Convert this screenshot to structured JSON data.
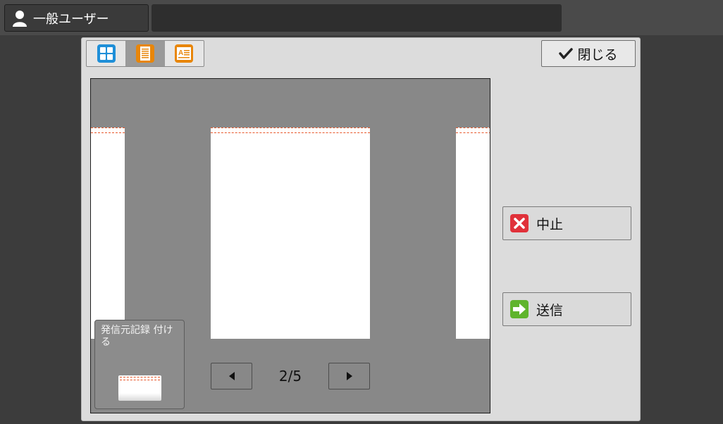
{
  "topbar": {
    "user_label": "一般ユーザー",
    "user_icon": "user-icon"
  },
  "toolbar": {
    "view_tabs": [
      {
        "icon": "grid-view-icon",
        "color": "#1f8fd8",
        "active": false
      },
      {
        "icon": "page-view-icon",
        "color": "#e8860a",
        "active": true
      },
      {
        "icon": "text-page-view-icon",
        "color": "#e8860a",
        "active": false
      }
    ],
    "close_label": "閉じる",
    "close_icon": "checkmark-icon"
  },
  "preview": {
    "stamp_label": "発信元記録 付ける",
    "page_counter": "2/5",
    "stamp_color": "#e8572a"
  },
  "actions": {
    "stop_label": "中止",
    "stop_icon": "x-icon",
    "stop_color": "#e0313a",
    "send_label": "送信",
    "send_icon": "arrow-right-icon",
    "send_color": "#5fb42c"
  }
}
